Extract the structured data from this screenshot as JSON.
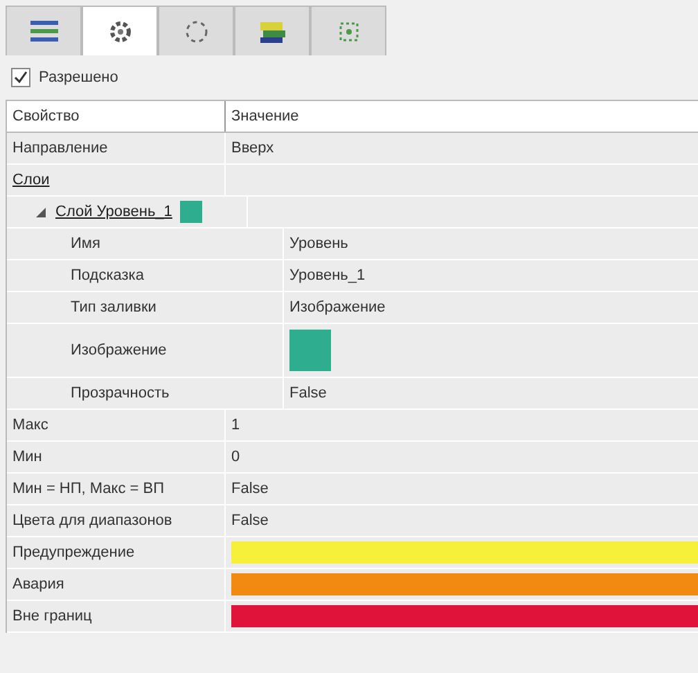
{
  "tabs": [
    {
      "selected": false
    },
    {
      "selected": true
    },
    {
      "selected": false
    },
    {
      "selected": false
    },
    {
      "selected": false
    }
  ],
  "enabled": {
    "label": "Разрешено",
    "checked": true
  },
  "table": {
    "columns": [
      "Свойство",
      "Значение"
    ],
    "rows": [
      {
        "kind": "text",
        "name": "Направление",
        "value": "Вверх"
      },
      {
        "kind": "group",
        "name": "Слои"
      },
      {
        "kind": "node",
        "name": "Слой Уровень_1",
        "color": "#2fae8f",
        "expanded": true,
        "children": [
          {
            "kind": "text",
            "name": "Имя",
            "value": "Уровень"
          },
          {
            "kind": "text",
            "name": "Подсказка",
            "value": "Уровень_1"
          },
          {
            "kind": "text",
            "name": "Тип заливки",
            "value": "Изображение"
          },
          {
            "kind": "image",
            "name": "Изображение",
            "color": "#2fae8f"
          },
          {
            "kind": "text",
            "name": "Прозрачность",
            "value": "False"
          }
        ]
      },
      {
        "kind": "text",
        "name": "Макс",
        "value": "1"
      },
      {
        "kind": "text",
        "name": "Мин",
        "value": "0"
      },
      {
        "kind": "text",
        "name": "Мин = НП, Макс = ВП",
        "value": "False"
      },
      {
        "kind": "text",
        "name": "Цвета для диапазонов",
        "value": "False"
      },
      {
        "kind": "bar",
        "name": "Предупреждение",
        "color": "#f6f03a"
      },
      {
        "kind": "bar",
        "name": "Авария",
        "color": "#f28a12"
      },
      {
        "kind": "bar",
        "name": "Вне границ",
        "color": "#e0133a"
      }
    ]
  }
}
